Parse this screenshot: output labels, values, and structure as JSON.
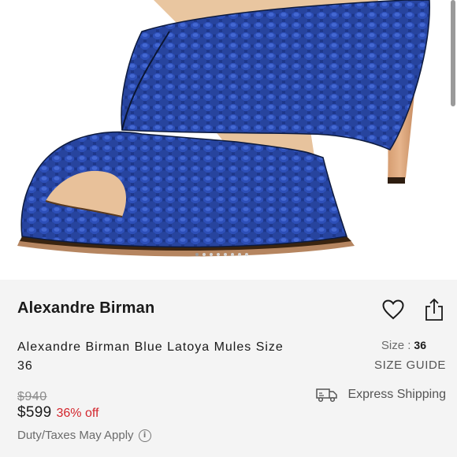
{
  "product": {
    "brand": "Alexandre Birman",
    "title": "Alexandre Birman Blue Latoya Mules Size 36",
    "size_label": "Size :",
    "size_value": "36",
    "size_guide": "SIZE GUIDE",
    "original_price": "$940",
    "price": "$599",
    "discount": "36% off",
    "duty_note": "Duty/Taxes May Apply",
    "shipping": "Express Shipping"
  },
  "gallery": {
    "image_count": 8,
    "active_index": 0
  },
  "icons": {
    "like": "heart-icon",
    "share": "share-icon",
    "info": "info-icon",
    "shipping": "truck-icon"
  },
  "colors": {
    "accent_discount": "#d3262d",
    "shoe_blue": "#1e3a8f",
    "panel_bg": "#f4f4f4"
  }
}
